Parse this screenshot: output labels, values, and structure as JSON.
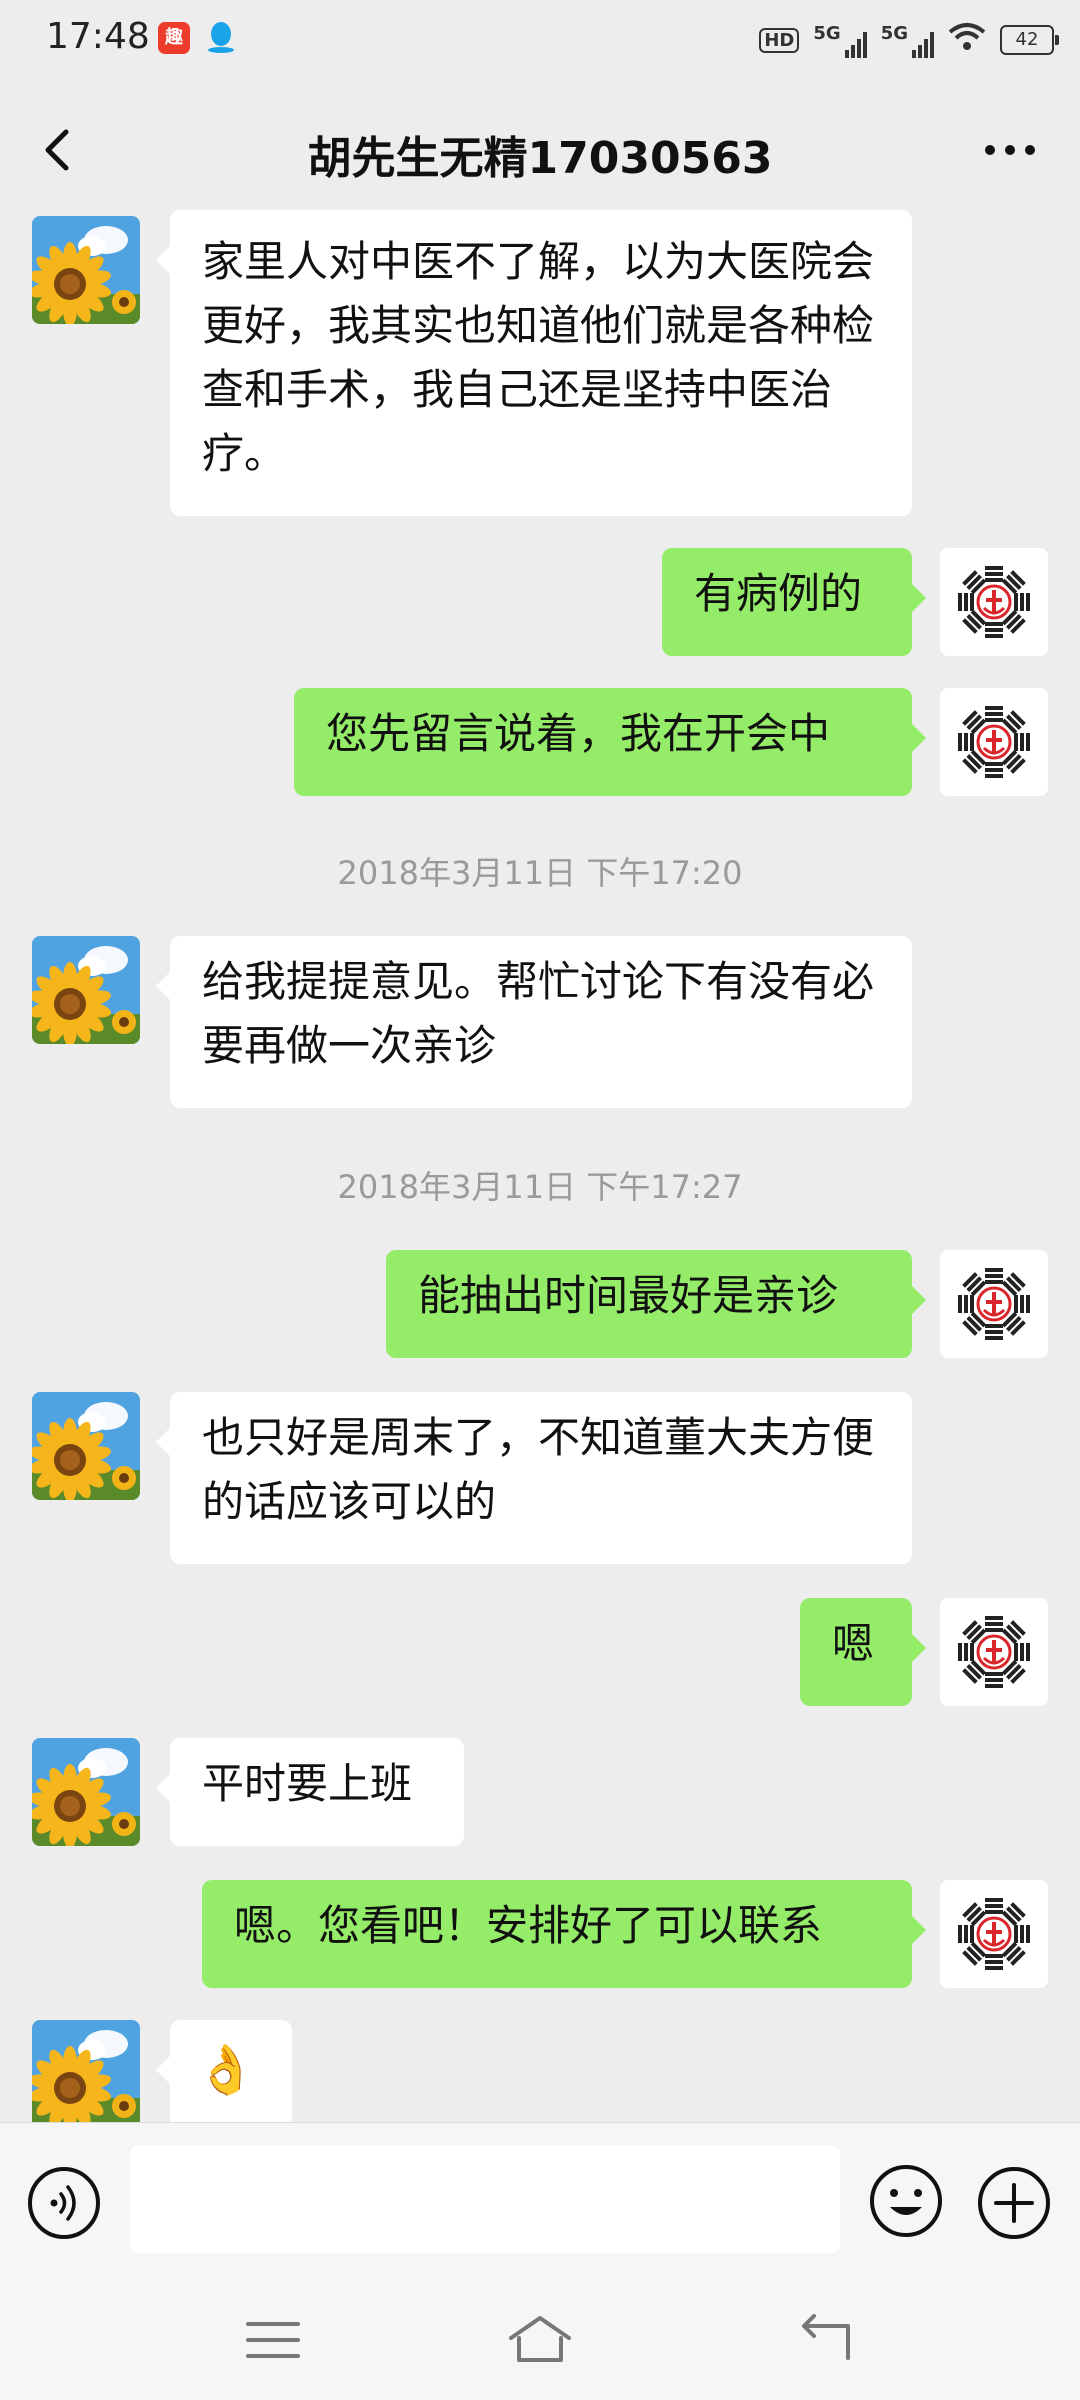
{
  "status_bar": {
    "time": "17:48",
    "hd_label": "HD",
    "network1": "5G",
    "network2": "5G",
    "battery": "42",
    "icons": [
      "notification-app-icon",
      "qq-icon",
      "hd-icon",
      "signal-icon",
      "wifi-icon",
      "battery-icon"
    ]
  },
  "header": {
    "title": "胡先生无精17030563",
    "back_icon": "chevron-left-icon",
    "more_icon": "more-dots-icon"
  },
  "messages": [
    {
      "side": "in",
      "type": "text",
      "text": "家里人对中医不了解，以为大医院会更好，我其实也知道他们就是各种检查和手术，我自己还是坚持中医治疗。"
    },
    {
      "side": "out",
      "type": "text",
      "text": "有病例的"
    },
    {
      "side": "out",
      "type": "text",
      "text": "您先留言说着，我在开会中"
    },
    {
      "type": "timestamp",
      "text": "2018年3月11日 下午17:20"
    },
    {
      "side": "in",
      "type": "text",
      "text": "给我提提意见。帮忙讨论下有没有必要再做一次亲诊"
    },
    {
      "type": "timestamp",
      "text": "2018年3月11日 下午17:27"
    },
    {
      "side": "out",
      "type": "text",
      "text": "能抽出时间最好是亲诊"
    },
    {
      "side": "in",
      "type": "text",
      "text": "也只好是周末了，不知道董大夫方便的话应该可以的"
    },
    {
      "side": "out",
      "type": "text",
      "text": "嗯"
    },
    {
      "side": "in",
      "type": "text",
      "text": "平时要上班"
    },
    {
      "side": "out",
      "type": "text",
      "text": "嗯。您看吧！安排好了可以联系"
    },
    {
      "side": "in",
      "type": "emoji",
      "emoji": "👌"
    }
  ],
  "input_bar": {
    "placeholder": "",
    "voice_icon": "voice-icon",
    "emoji_icon": "emoji-icon",
    "plus_icon": "plus-icon"
  },
  "nav_bar": {
    "icons": [
      "menu-icon",
      "home-icon",
      "back-icon"
    ]
  },
  "colors": {
    "background": "#ededed",
    "sent_bubble": "#95ec69",
    "received_bubble": "#ffffff",
    "timestamp_text": "#9a9a9a"
  }
}
